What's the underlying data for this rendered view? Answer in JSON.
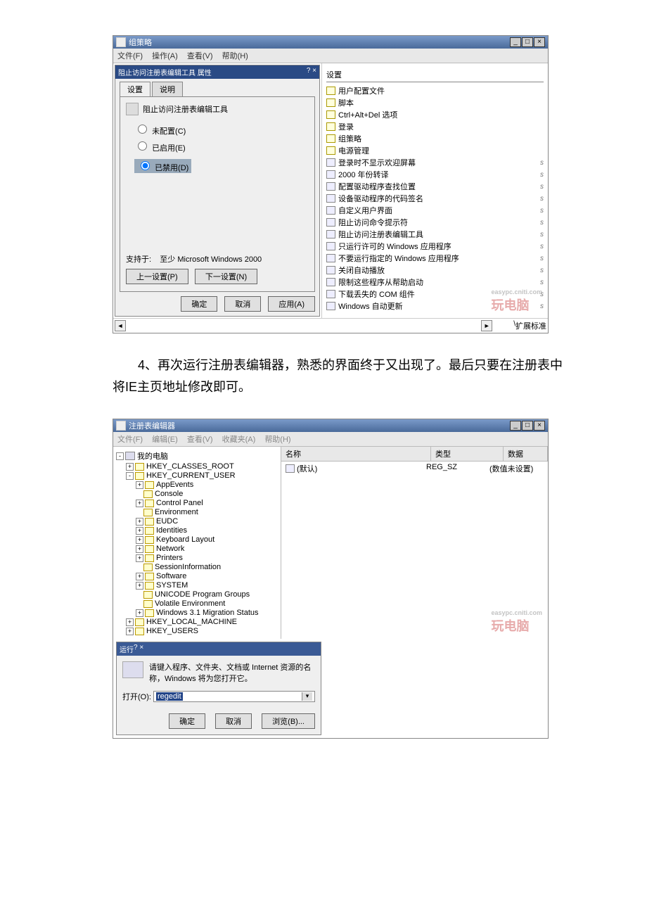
{
  "shot1": {
    "window_title": "组策略",
    "menu": {
      "file": "文件(F)",
      "action": "操作(A)",
      "view": "查看(V)",
      "help": "帮助(H)"
    },
    "dialog": {
      "title": "阻止访问注册表编辑工具 属性",
      "tab_settings": "设置",
      "tab_explain": "说明",
      "policy_name": "阻止访问注册表编辑工具",
      "radio_not_configured": "未配置(C)",
      "radio_enabled": "已启用(E)",
      "radio_disabled": "已禁用(D)",
      "supported_label": "支持于:",
      "supported_value": "至少 Microsoft Windows 2000",
      "prev": "上一设置(P)",
      "next": "下一设置(N)",
      "ok": "确定",
      "cancel": "取消",
      "apply": "应用(A)"
    },
    "right_header": "设置",
    "right_items_folders": [
      "用户配置文件",
      "脚本",
      "Ctrl+Alt+Del 选项",
      "登录",
      "组策略",
      "电源管理"
    ],
    "right_items_policies": [
      "登录时不显示欢迎屏幕",
      "2000 年份转译",
      "配置驱动程序查找位置",
      "设备驱动程序的代码签名",
      "自定义用户界面",
      "阻止访问命令提示符",
      "阻止访问注册表编辑工具",
      "只运行许可的 Windows 应用程序",
      "不要运行指定的 Windows 应用程序",
      "关闭自动播放",
      "限制这些程序从帮助启动",
      "下载丢失的 COM 组件",
      "Windows 自动更新"
    ],
    "footer_tab_ext": "扩展",
    "footer_tab_std": "标准",
    "watermark_text": "玩电脑",
    "watermark_url": "easypc.cniti.com"
  },
  "bodytext": "4、再次运行注册表编辑器，熟悉的界面终于又出现了。最后只要在注册表中将IE主页地址修改即可。",
  "shot2": {
    "window_title": "注册表编辑器",
    "menu": {
      "file": "文件(F)",
      "edit": "编辑(E)",
      "view": "查看(V)",
      "fav": "收藏夹(A)",
      "help": "帮助(H)"
    },
    "root": "我的电脑",
    "tree": [
      {
        "depth": 1,
        "exp": "+",
        "label": "HKEY_CLASSES_ROOT"
      },
      {
        "depth": 1,
        "exp": "-",
        "label": "HKEY_CURRENT_USER"
      },
      {
        "depth": 2,
        "exp": "+",
        "label": "AppEvents"
      },
      {
        "depth": 2,
        "exp": " ",
        "label": "Console"
      },
      {
        "depth": 2,
        "exp": "+",
        "label": "Control Panel"
      },
      {
        "depth": 2,
        "exp": " ",
        "label": "Environment"
      },
      {
        "depth": 2,
        "exp": "+",
        "label": "EUDC"
      },
      {
        "depth": 2,
        "exp": "+",
        "label": "Identities"
      },
      {
        "depth": 2,
        "exp": "+",
        "label": "Keyboard Layout"
      },
      {
        "depth": 2,
        "exp": "+",
        "label": "Network"
      },
      {
        "depth": 2,
        "exp": "+",
        "label": "Printers"
      },
      {
        "depth": 2,
        "exp": " ",
        "label": "SessionInformation"
      },
      {
        "depth": 2,
        "exp": "+",
        "label": "Software"
      },
      {
        "depth": 2,
        "exp": "+",
        "label": "SYSTEM"
      },
      {
        "depth": 2,
        "exp": " ",
        "label": "UNICODE Program Groups"
      },
      {
        "depth": 2,
        "exp": " ",
        "label": "Volatile Environment"
      },
      {
        "depth": 2,
        "exp": "+",
        "label": "Windows 3.1 Migration Status"
      },
      {
        "depth": 1,
        "exp": "+",
        "label": "HKEY_LOCAL_MACHINE"
      },
      {
        "depth": 1,
        "exp": "+",
        "label": "HKEY_USERS"
      }
    ],
    "cols": {
      "name": "名称",
      "type": "类型",
      "data": "数据"
    },
    "row": {
      "name": "(默认)",
      "type": "REG_SZ",
      "data": "(数值未设置)"
    },
    "run": {
      "title": "运行",
      "msg": "请键入程序、文件夹、文档或 Internet 资源的名称，Windows 将为您打开它。",
      "open_label": "打开(O):",
      "input_value": "regedit",
      "ok": "确定",
      "cancel": "取消",
      "browse": "浏览(B)..."
    }
  }
}
